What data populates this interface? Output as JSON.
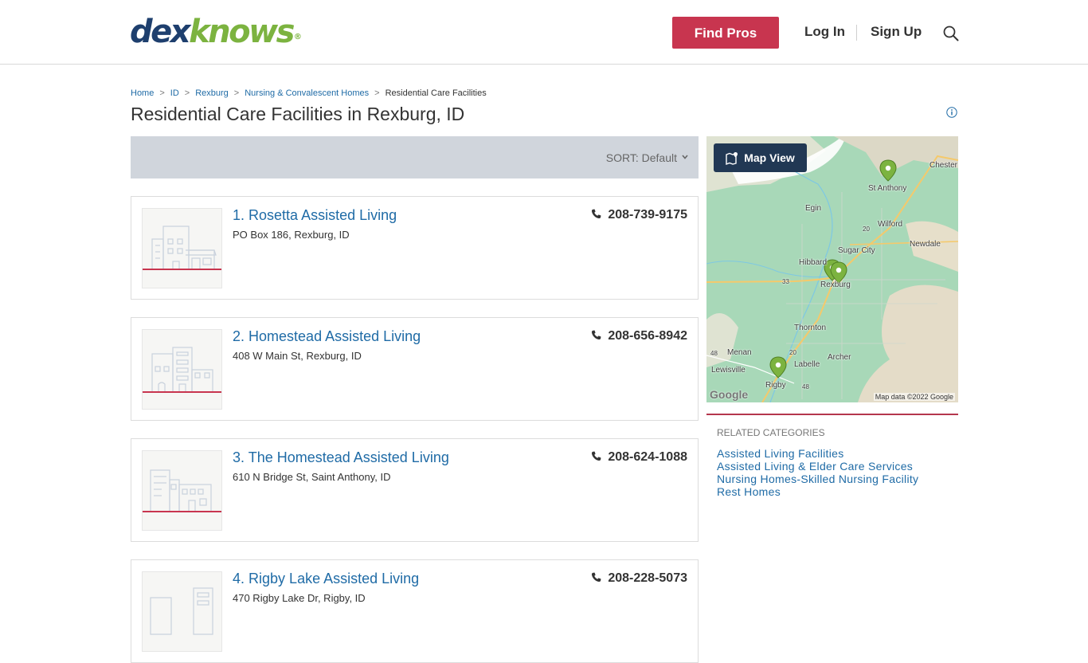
{
  "header": {
    "logo_dex": "dex",
    "logo_knows": "knows",
    "logo_reg": "®",
    "find_pros_label": "Find Pros",
    "login_label": "Log In",
    "signup_label": "Sign Up"
  },
  "breadcrumb": [
    {
      "label": "Home"
    },
    {
      "label": "ID"
    },
    {
      "label": "Rexburg"
    },
    {
      "label": "Nursing & Convalescent Homes"
    },
    {
      "label": "Residential Care Facilities"
    }
  ],
  "page_title": "Residential Care Facilities in Rexburg, ID",
  "sort": {
    "label": "SORT: Default"
  },
  "listings": [
    {
      "number": "1.",
      "name": "Rosetta Assisted Living",
      "address": "PO Box 186, Rexburg, ID",
      "phone": "208-739-9175"
    },
    {
      "number": "2.",
      "name": "Homestead Assisted Living",
      "address": "408 W Main St, Rexburg, ID",
      "phone": "208-656-8942"
    },
    {
      "number": "3.",
      "name": "The Homestead Assisted Living",
      "address": "610 N Bridge St, Saint Anthony, ID",
      "phone": "208-624-1088"
    },
    {
      "number": "4.",
      "name": "Rigby Lake Assisted Living",
      "address": "470 Rigby Lake Dr, Rigby, ID",
      "phone": "208-228-5073"
    }
  ],
  "map": {
    "button_label": "Map View",
    "labels": [
      "Chester",
      "St Anthony",
      "Egin",
      "Wilford",
      "Newdale",
      "Sugar City",
      "Hibbard",
      "Rexburg",
      "Thornton",
      "Menan",
      "Labelle",
      "Archer",
      "Lewisville",
      "Rigby",
      "20",
      "33",
      "20",
      "48",
      "48"
    ],
    "attribution": "Map data ©2022 Google",
    "google": "Google"
  },
  "related": {
    "heading": "RELATED CATEGORIES",
    "items": [
      "Assisted Living Facilities",
      "Assisted Living & Elder Care Services",
      "Nursing Homes-Skilled Nursing Facility",
      "Rest Homes"
    ]
  },
  "colors": {
    "brand_navy": "#1e3f6e",
    "brand_green": "#7cb340",
    "accent_red": "#c8354f",
    "link_blue": "#1f6ba6"
  }
}
